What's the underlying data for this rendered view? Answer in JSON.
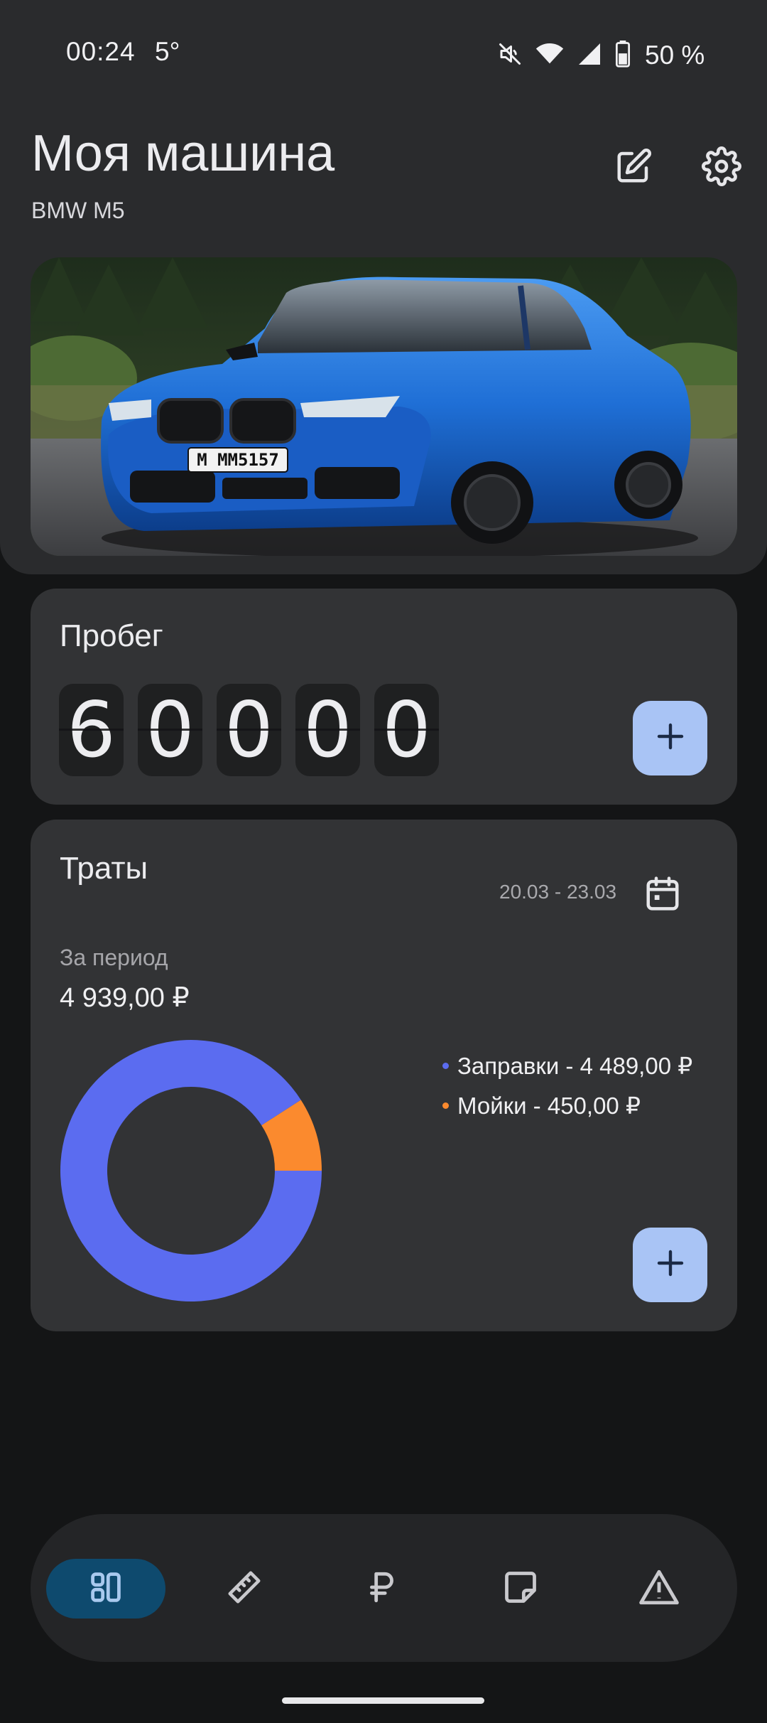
{
  "status_bar": {
    "time": "00:24",
    "temperature": "5°",
    "battery": "50 %",
    "icons": [
      "mute-icon",
      "wifi-icon",
      "signal-icon",
      "battery-icon"
    ]
  },
  "header": {
    "title": "Моя машина",
    "subtitle": "BMW M5",
    "actions": [
      "edit-icon",
      "settings-icon"
    ]
  },
  "car_photo": {
    "plate": "M MM5157",
    "body_color": "#1f6fd6"
  },
  "mileage": {
    "title": "Пробег",
    "digits": [
      "6",
      "0",
      "0",
      "0",
      "0"
    ]
  },
  "expenses": {
    "title": "Траты",
    "date_range": "20.03 - 23.03",
    "period_label": "За период",
    "period_total": "4 939,00 ₽",
    "legend": [
      {
        "label": "Заправки - 4 489,00 ₽",
        "color": "#5b6cf0",
        "value": 4489.0
      },
      {
        "label": "Мойки - 450,00 ₽",
        "color": "#fb8a2e",
        "value": 450.0
      }
    ]
  },
  "bottom_nav": {
    "items": [
      {
        "name": "dashboard",
        "icon": "dashboard-icon",
        "active": true
      },
      {
        "name": "ruler",
        "icon": "ruler-icon",
        "active": false
      },
      {
        "name": "expenses",
        "icon": "ruble-icon",
        "active": false
      },
      {
        "name": "notes",
        "icon": "note-icon",
        "active": false
      },
      {
        "name": "warnings",
        "icon": "warning-icon",
        "active": false
      }
    ]
  },
  "colors": {
    "accent_button": "#a9c4f5",
    "active_nav": "#0e4a6e",
    "background": "#141516",
    "card": "#323335"
  }
}
